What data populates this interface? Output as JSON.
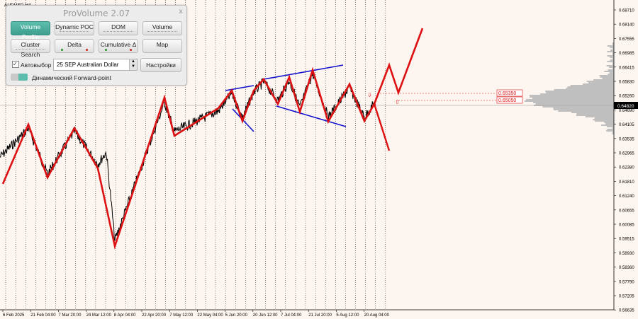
{
  "chart": {
    "symbol_label": "AUDUSD,H4",
    "current_price": "0.64820",
    "price_axis": [
      "0.68710",
      "0.68140",
      "0.67555",
      "0.66985",
      "0.66415",
      "0.65830",
      "0.65260",
      "0.64690",
      "0.64105",
      "0.63535",
      "0.62965",
      "0.62380",
      "0.61810",
      "0.61240",
      "0.60655",
      "0.60085",
      "0.59515",
      "0.58930",
      "0.58360",
      "0.57790",
      "0.57205",
      "0.56635"
    ],
    "time_axis": [
      "6 Feb 2025",
      "21 Feb 04:00",
      "7 Mar 20:00",
      "24 Mar 12:00",
      "8 Apr 04:00",
      "22 Apr 20:00",
      "7 May 12:00",
      "22 May 04:00",
      "5 Jun 20:00",
      "20 Jun 12:00",
      "7 Jul 04:00",
      "21 Jul 20:00",
      "5 Aug 12:00",
      "20 Aug 04:00"
    ],
    "level_labels": [
      "0.65350",
      "0.65050"
    ],
    "colors": {
      "price": "#000000",
      "wave": "#dd1111",
      "trend": "#1111cc",
      "profile": "#bfbfbf",
      "grid": "#000000",
      "background": "#fdf5f0"
    }
  },
  "provolume": {
    "title": "ProVolume 2.07",
    "close": "x",
    "buttons": [
      {
        "label": "Volume Profile",
        "active": true
      },
      {
        "label": "Dynamic POC",
        "active": false
      },
      {
        "label": "DOM",
        "active": false
      },
      {
        "label": "Volume",
        "active": false
      },
      {
        "label": "Cluster Search",
        "active": false
      },
      {
        "label": "Delta",
        "active": false
      },
      {
        "label": "Cumulative Δ",
        "active": false
      },
      {
        "label": "Map",
        "active": false
      }
    ],
    "auto_select_label": "Автовыбор",
    "auto_select_checked": true,
    "instrument_value": "25 SEP Australian Dollar",
    "settings_label": "Настройки",
    "forward_point_label": "Динамический Forward-point"
  }
}
